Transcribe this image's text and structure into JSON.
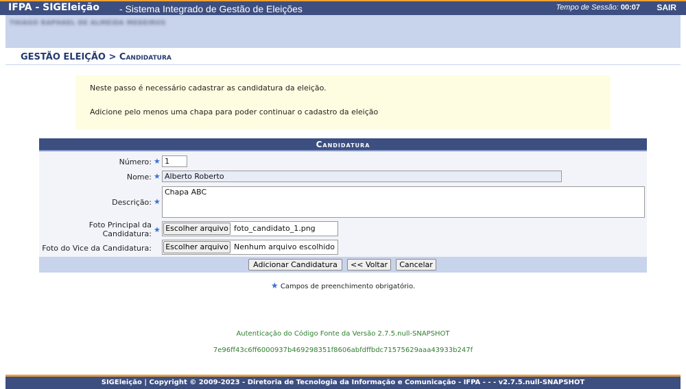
{
  "topbar": {
    "system_name": "IFPA - SIGEleição",
    "system_desc": "- Sistema Integrado de Gestão de Eleições",
    "session_label": "Tempo de Sessão:",
    "session_time": "00:07",
    "logout_label": "SAIR"
  },
  "user": {
    "name": "THIAGO RAPHAEL DE ALMEIDA MEDEIROS"
  },
  "breadcrumb": {
    "section": "GESTÃO ELEIÇÃO >",
    "page": "Candidatura"
  },
  "info": {
    "line1": "Neste passo é necessário cadastrar as candidatura da eleição.",
    "line2": "Adicione pelo menos uma chapa para poder continuar o cadastro da eleição"
  },
  "form": {
    "caption": "Candidatura",
    "numero_label": "Número:",
    "numero_value": "1",
    "nome_label": "Nome:",
    "nome_value": "Alberto Roberto",
    "descricao_label": "Descrição:",
    "descricao_value": "Chapa ABC",
    "foto_principal_label_1": "Foto Principal da",
    "foto_principal_label_2": "Candidatura:",
    "foto_principal_button": "Escolher arquivo",
    "foto_principal_file": "foto_candidato_1.png",
    "foto_vice_label": "Foto do Vice da Candidatura:",
    "foto_vice_button": "Escolher arquivo",
    "foto_vice_file": "Nenhum arquivo escolhido",
    "required_star": "★",
    "buttons": {
      "add": "Adicionar Candidatura",
      "back": "<< Voltar",
      "cancel": "Cancelar"
    }
  },
  "required_note": "Campos de preenchimento obrigatório.",
  "auth": {
    "line1": "Autenticação do Código Fonte da Versão 2.7.5.null-SNAPSHOT",
    "hash": "7e96ff43c6ff6000937b469298351f8606abfdffbdc71575629aaa43933b247f"
  },
  "footer": {
    "text": "SIGEleição | Copyright © 2009-2023 - Diretoria de Tecnologia da Informação e Comunicação - IFPA - - - v2.7.5.null-SNAPSHOT"
  },
  "colors": {
    "header_bg": "#3d4f80",
    "accent_orange": "#f0a030",
    "band_bg": "#c8d3ec",
    "info_bg": "#fffde1",
    "required_star": "#3b6fd2",
    "auth_text": "#2f7d2f"
  }
}
